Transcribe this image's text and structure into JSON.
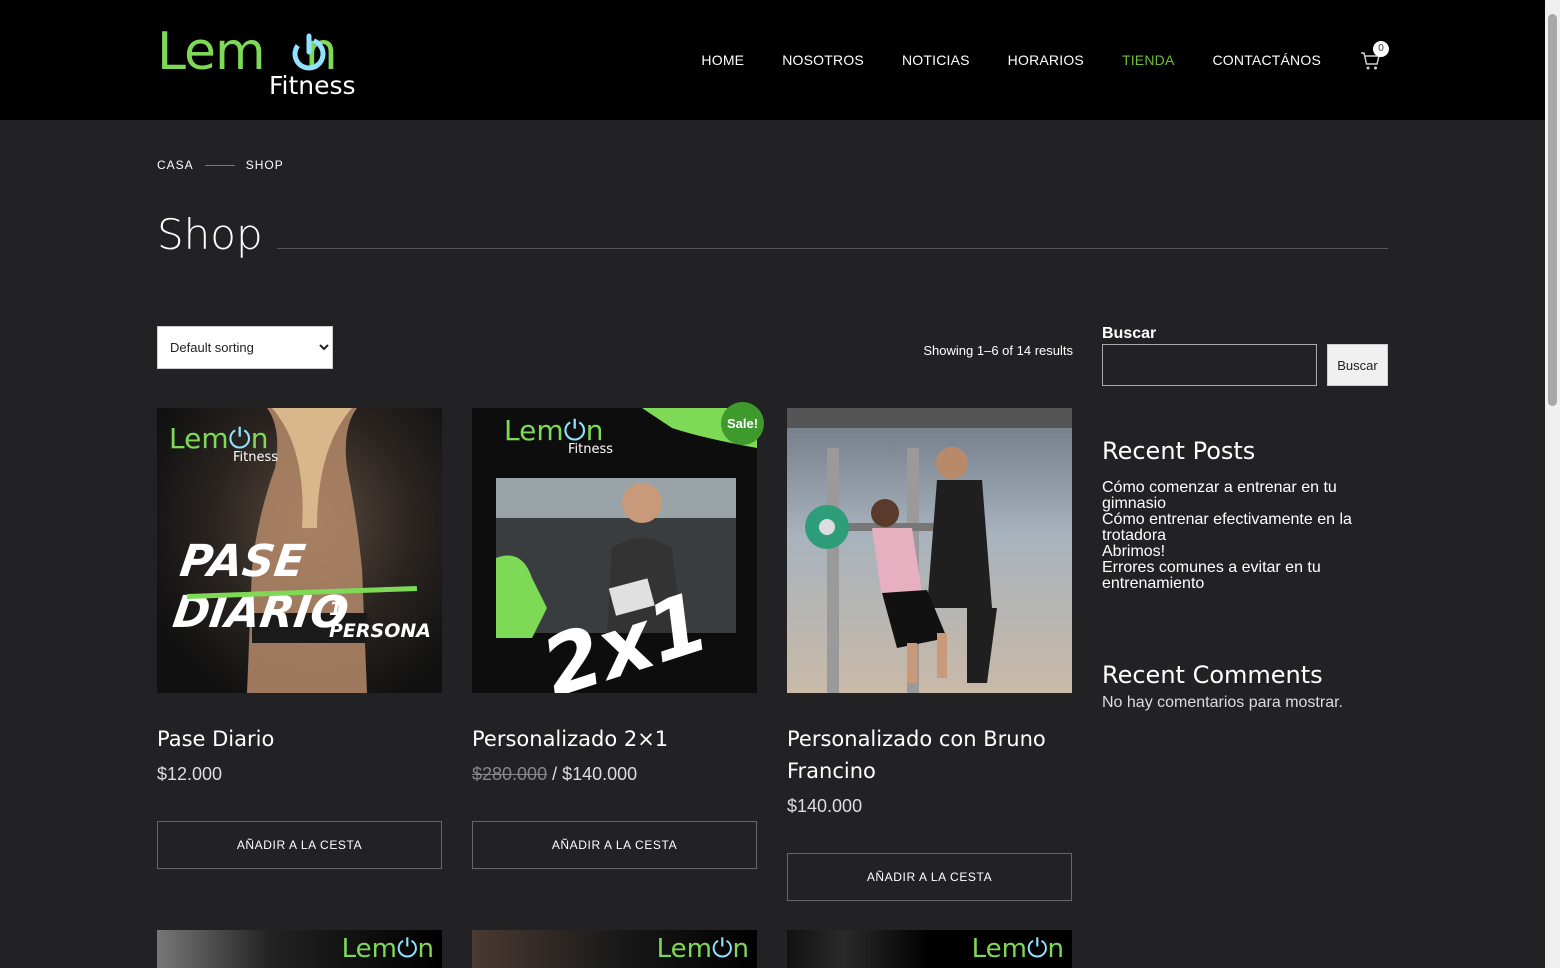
{
  "header": {
    "logo_main": "Lem",
    "logo_tail": "n",
    "logo_sub": "Fitness",
    "nav": [
      {
        "label": "HOME",
        "active": false
      },
      {
        "label": "NOSOTROS",
        "active": false
      },
      {
        "label": "NOTICIAS",
        "active": false
      },
      {
        "label": "HORARIOS",
        "active": false
      },
      {
        "label": "TIENDA",
        "active": true
      },
      {
        "label": "CONTACTÁNOS",
        "active": false
      }
    ],
    "cart_count": "0"
  },
  "breadcrumb": [
    "CASA",
    "SHOP"
  ],
  "page_title": "Shop",
  "toolbar": {
    "sort_selected": "Default sorting",
    "result_count": "Showing 1–6 of 14 results"
  },
  "products": [
    {
      "name": "Pase Diario",
      "price": "$12.000",
      "old_price": "",
      "button": "AÑADIR A LA CESTA",
      "image_text_line1": "PASE DIARIO",
      "image_text_line2": "1 PERSONA"
    },
    {
      "name": "Personalizado 2×1",
      "price": "$140.000",
      "old_price": "$280.000",
      "price_sep": " / ",
      "button": "AÑADIR A LA CESTA",
      "sale": "Sale!",
      "image_text": "2x1"
    },
    {
      "name": "Personalizado con Bruno Francino",
      "price": "$140.000",
      "old_price": "",
      "button": "AÑADIR A LA CESTA"
    }
  ],
  "image_logo": {
    "main": "Lem",
    "tail": "n",
    "sub": "Fitness"
  },
  "sidebar": {
    "search_label": "Buscar",
    "search_button": "Buscar",
    "search_value": "",
    "recent_posts_title": "Recent Posts",
    "recent_posts": [
      "Cómo comenzar a entrenar en tu gimnasio",
      "Cómo entrenar efectivamente en la trotadora",
      "Abrimos!",
      "Errores comunes a evitar en tu entrenamiento"
    ],
    "recent_comments_title": "Recent Comments",
    "no_comments": "No hay comentarios para mostrar."
  },
  "colors": {
    "background": "#222224",
    "header": "#000000",
    "accent_green": "#6fbf3a",
    "logo_green": "#7ed957",
    "sale_badge": "#3e9a2c"
  }
}
